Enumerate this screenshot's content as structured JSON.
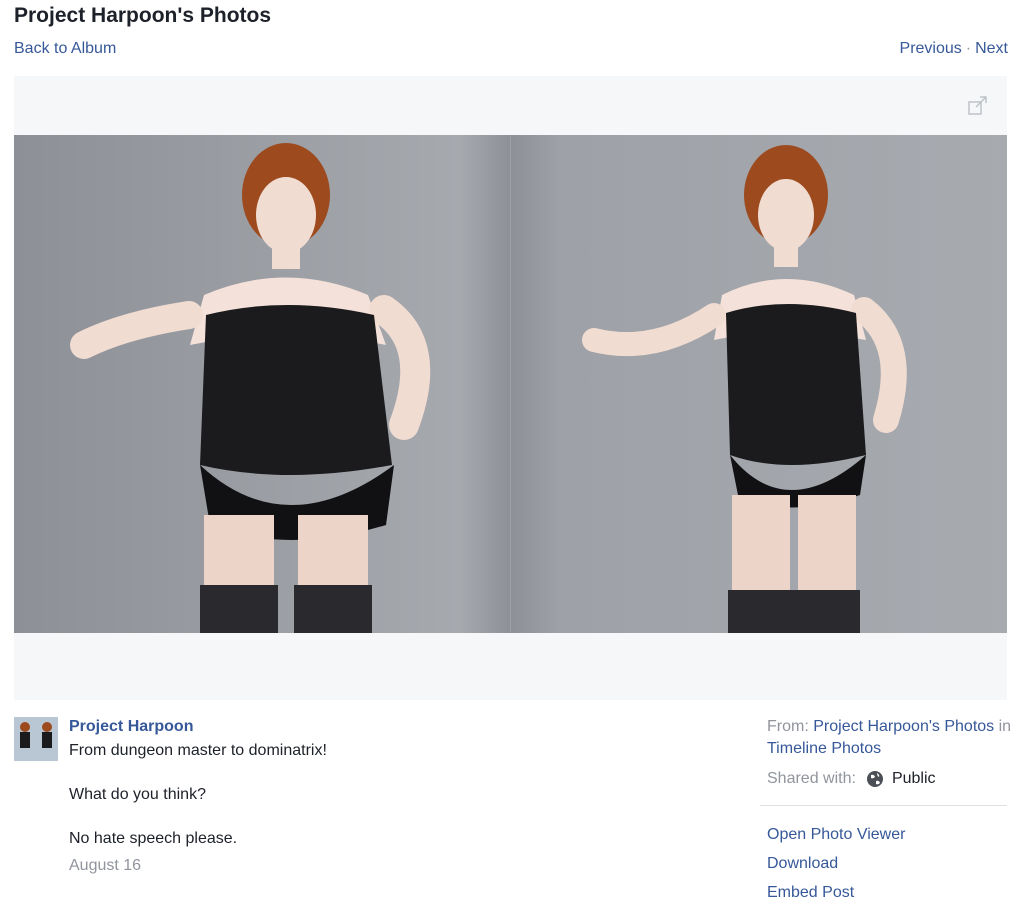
{
  "header": {
    "title": "Project Harpoon's Photos",
    "back_label": "Back to Album",
    "previous_label": "Previous",
    "separator": "·",
    "next_label": "Next"
  },
  "viewer": {
    "expand_icon": "expand-icon",
    "photo_icon": "photo"
  },
  "post": {
    "author": "Project Harpoon",
    "caption_lines": [
      "From dungeon master to dominatrix!",
      "What do you think?",
      "No hate speech please."
    ],
    "date": "August 16"
  },
  "sidebar": {
    "from_label": "From:",
    "from_link_1": "Project Harpoon's Photos",
    "in_word": "in",
    "from_link_2": "Timeline Photos",
    "shared_label": "Shared with:",
    "privacy_icon": "globe-icon",
    "privacy_value": "Public",
    "links": [
      "Open Photo Viewer",
      "Download",
      "Embed Post"
    ]
  },
  "colors": {
    "link": "#365899",
    "muted": "#90949c",
    "stage_bg": "#f6f7f9"
  }
}
